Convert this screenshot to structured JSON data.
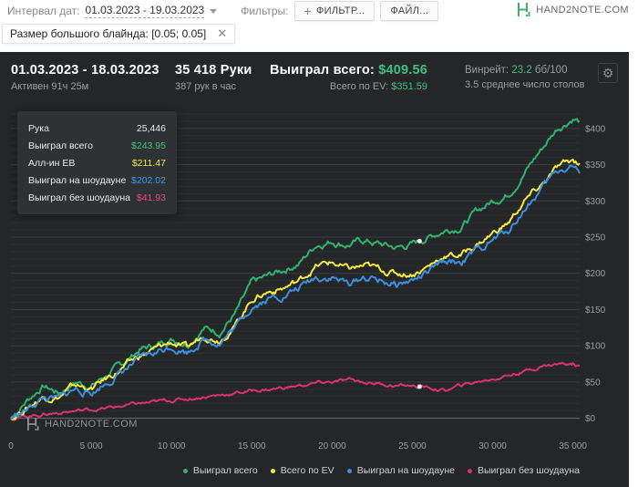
{
  "toolbar": {
    "date_label": "Интервал дат:",
    "date_range": "01.03.2023 - 19.03.2023",
    "filters_label": "Фильтры:",
    "filter_button": "ФИЛЬТР...",
    "file_button": "ФАЙЛ...",
    "logo_text": "HAND2NOTE.COM"
  },
  "filter_chip": {
    "label": "Размер большого блайнда: [0.05; 0.05]",
    "close": "✕"
  },
  "summary": {
    "range": "01.03.2023 - 18.03.2023",
    "active": "Активен 91ч 25м",
    "hands": "35 418 Руки",
    "hands_per_hour": "387 рук в час",
    "won_label": "Выиграл всего:",
    "won_value": "$409.56",
    "ev_label": "Всего по EV:",
    "ev_value": "$351.59",
    "winrate_label": "Винрейт:",
    "winrate_value": "23.2",
    "winrate_unit": "бб/100",
    "avg_tables": "3.5 среднее число столов",
    "settings_icon": "gear-icon"
  },
  "tooltip": {
    "hand_label": "Рука",
    "hand_value": "25,446",
    "won_label": "Выиграл всего",
    "won_value": "$243.95",
    "allin_label": "Алл-ин EB",
    "allin_value": "$211.47",
    "sd_label": "Выиграл на шоудауне",
    "sd_value": "$202.02",
    "nosd_label": "Выиграл без шоудауна",
    "nosd_value": "$41.93"
  },
  "watermark": "HAND2NOTE.COM",
  "colors": {
    "green": "#2fb36d",
    "yellow": "#f4ea3e",
    "blue": "#3d8fdc",
    "pink": "#d8346b",
    "panel": "#242628"
  },
  "chart_data": {
    "type": "line",
    "x": [
      0,
      1000,
      2000,
      3000,
      4000,
      5000,
      6000,
      7000,
      8000,
      9000,
      10000,
      11000,
      12000,
      13000,
      14000,
      15000,
      16000,
      17000,
      18000,
      19000,
      20000,
      21000,
      22000,
      23000,
      24000,
      25000,
      26000,
      27000,
      28000,
      29000,
      30000,
      31000,
      32000,
      33000,
      34000,
      35000,
      35418
    ],
    "series": [
      {
        "name": "Выиграл всего",
        "values": [
          0,
          25,
          45,
          35,
          50,
          45,
          60,
          75,
          95,
          100,
          110,
          105,
          125,
          120,
          145,
          185,
          195,
          205,
          215,
          240,
          245,
          240,
          245,
          240,
          235,
          240,
          250,
          260,
          265,
          285,
          300,
          310,
          340,
          370,
          400,
          415,
          410
        ]
      },
      {
        "name": "Всего по EV",
        "values": [
          0,
          15,
          30,
          30,
          45,
          40,
          55,
          70,
          85,
          95,
          105,
          95,
          115,
          110,
          130,
          165,
          175,
          180,
          190,
          210,
          215,
          205,
          210,
          205,
          200,
          200,
          210,
          225,
          225,
          240,
          255,
          270,
          300,
          320,
          345,
          355,
          352
        ]
      },
      {
        "name": "Выиграл на шоудауне",
        "values": [
          0,
          12,
          28,
          25,
          40,
          35,
          50,
          65,
          80,
          90,
          100,
          92,
          110,
          105,
          125,
          155,
          165,
          170,
          180,
          195,
          195,
          185,
          195,
          190,
          185,
          190,
          200,
          215,
          215,
          230,
          245,
          260,
          290,
          315,
          340,
          350,
          338
        ]
      },
      {
        "name": "Выиграл без шоудауна",
        "values": [
          0,
          3,
          6,
          8,
          10,
          12,
          14,
          17,
          20,
          22,
          25,
          27,
          30,
          32,
          35,
          38,
          40,
          42,
          45,
          48,
          50,
          52,
          50,
          48,
          45,
          45,
          42,
          38,
          45,
          50,
          55,
          60,
          65,
          72,
          75,
          76,
          72
        ]
      }
    ],
    "xticks": [
      "0",
      "5 000",
      "10 000",
      "15 000",
      "20 000",
      "25 000",
      "30 000",
      "35 000"
    ],
    "xtick_values": [
      0,
      5000,
      10000,
      15000,
      20000,
      25000,
      30000,
      35000
    ],
    "yticks": [
      "$0",
      "$50",
      "$100",
      "$150",
      "$200",
      "$250",
      "$300",
      "$350",
      "$400"
    ],
    "ytick_values": [
      0,
      50,
      100,
      150,
      200,
      250,
      300,
      350,
      400
    ],
    "xlim": [
      0,
      35418
    ],
    "ylim": [
      -8,
      430
    ],
    "grid": true,
    "legend": "bottom-right"
  }
}
